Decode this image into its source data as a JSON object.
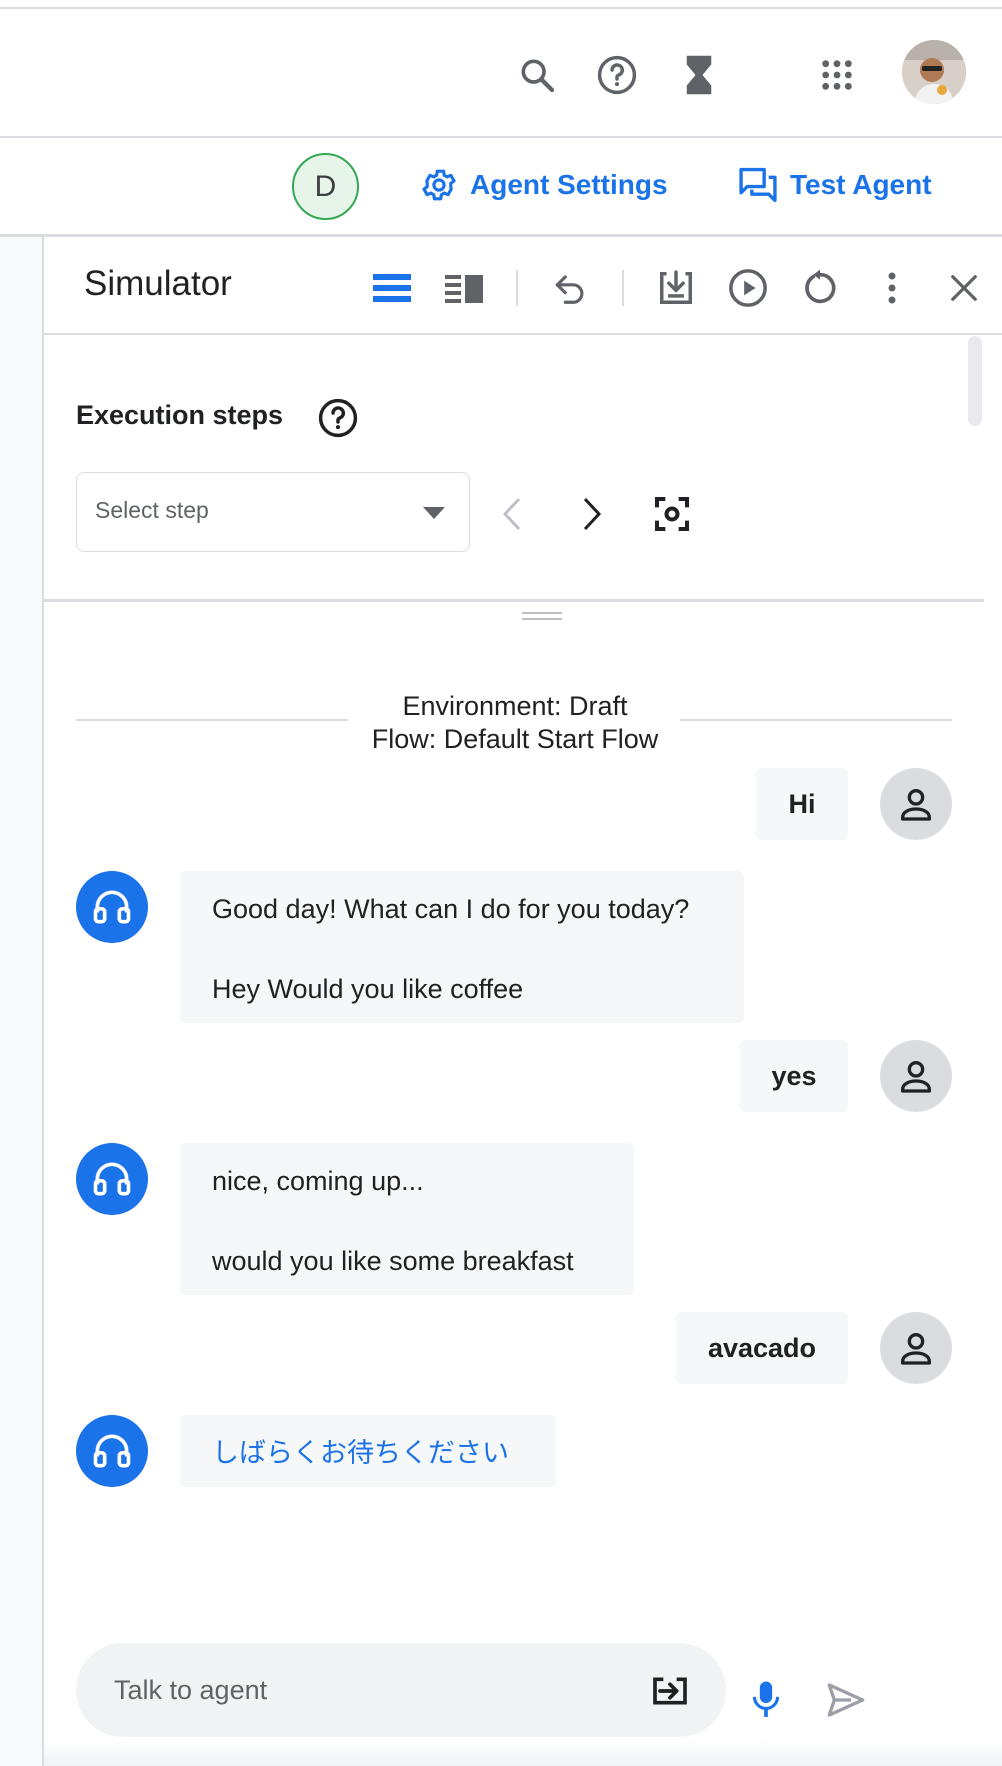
{
  "header": {
    "icons": [
      "search-icon",
      "help-icon",
      "hourglass-icon",
      "apps-grid-icon"
    ],
    "avatar": "user-avatar"
  },
  "subbar": {
    "badge_letter": "D",
    "agent_settings_label": "Agent Settings",
    "test_agent_label": "Test Agent"
  },
  "simulator": {
    "title": "Simulator",
    "toolbar_icons": [
      "list-view-icon",
      "split-view-icon",
      "undo-icon",
      "download-icon",
      "play-icon",
      "reset-icon",
      "more-vert-icon",
      "close-icon"
    ],
    "execution_steps": {
      "title": "Execution steps",
      "select_placeholder": "Select step"
    },
    "environment_label": "Environment: Draft",
    "flow_label": "Flow: Default Start Flow",
    "messages": [
      {
        "role": "user",
        "text": "Hi"
      },
      {
        "role": "agent",
        "lines": [
          "Good day! What can I do for you today?",
          "Hey Would you like coffee"
        ]
      },
      {
        "role": "user",
        "text": "yes"
      },
      {
        "role": "agent",
        "lines": [
          "nice, coming up...",
          "would you like some breakfast"
        ]
      },
      {
        "role": "user",
        "text": "avacado"
      },
      {
        "role": "agent",
        "lines": [
          "しばらくお待ちください"
        ],
        "link": true
      }
    ],
    "input": {
      "placeholder": "Talk to agent",
      "value": ""
    }
  },
  "colors": {
    "accent": "#1a73e8",
    "badge_border": "#34a853",
    "bubble_bg": "#f6f7f8",
    "divider": "#dadce0"
  }
}
